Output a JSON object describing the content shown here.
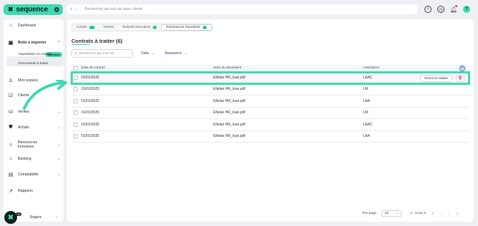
{
  "app": {
    "brand": "sequence",
    "workspace_initial": "S"
  },
  "topbar": {
    "search_placeholder": "Recherche par mot-clé dans clients"
  },
  "sidebar": {
    "items": [
      {
        "label": "Dashboard"
      },
      {
        "label": "Boîte à importer",
        "badge": "Nouveau"
      },
      {
        "label": "Mon espace"
      },
      {
        "label": "Clients"
      },
      {
        "label": "Ventes"
      },
      {
        "label": "Achats"
      },
      {
        "label": "Ressources humaines"
      },
      {
        "label": "Banking"
      },
      {
        "label": "Comptabilité"
      },
      {
        "label": "Rapports"
      }
    ],
    "subitems": [
      {
        "label": "Importation en masse"
      },
      {
        "label": "Documents à traiter"
      }
    ],
    "user": {
      "name": "Rogers",
      "badge": "11"
    }
  },
  "tabs": [
    {
      "label": "Achats",
      "count": "10"
    },
    {
      "label": "Ventes",
      "count": ""
    },
    {
      "label": "Relevés bancaires",
      "count": "2"
    },
    {
      "label": "Ressources humaines",
      "count": "6"
    }
  ],
  "page_title": "Contrats à traiter (6)",
  "filters": {
    "search_placeholder": "Recherche par mot-clé",
    "date_label": "Date",
    "insurance_label": "Assurance"
  },
  "table": {
    "headers": {
      "date": "Date du contrat",
      "doc": "Nom du document",
      "insurance": "Assurance"
    },
    "rows": [
      {
        "date": "01/01/2025",
        "doc": "Efielan HR_Ioan.pdf",
        "insurance": "LAAC"
      },
      {
        "date": "01/01/2025",
        "doc": "Efielan HR_Ioan.pdf",
        "insurance": "LM"
      },
      {
        "date": "01/01/2025",
        "doc": "Efielan HR_Ioan.pdf",
        "insurance": "LAA"
      },
      {
        "date": "01/01/2025",
        "doc": "Efielan HR_Ioan.pdf",
        "insurance": "LM"
      },
      {
        "date": "01/01/2025",
        "doc": "Efielan HR_Ioan.pdf",
        "insurance": "LAAC"
      },
      {
        "date": "01/01/2025",
        "doc": "Efielan HR_Ioan.pdf",
        "insurance": "LAA"
      }
    ],
    "review_button": "Revoir et valider"
  },
  "pagination": {
    "per_page_label": "Par page :",
    "per_page_value": "10",
    "range": "1 - 6 sur 6"
  },
  "colors": {
    "accent": "#3fd9b0",
    "link": "#2b3a66",
    "delete": "#dd3333"
  }
}
